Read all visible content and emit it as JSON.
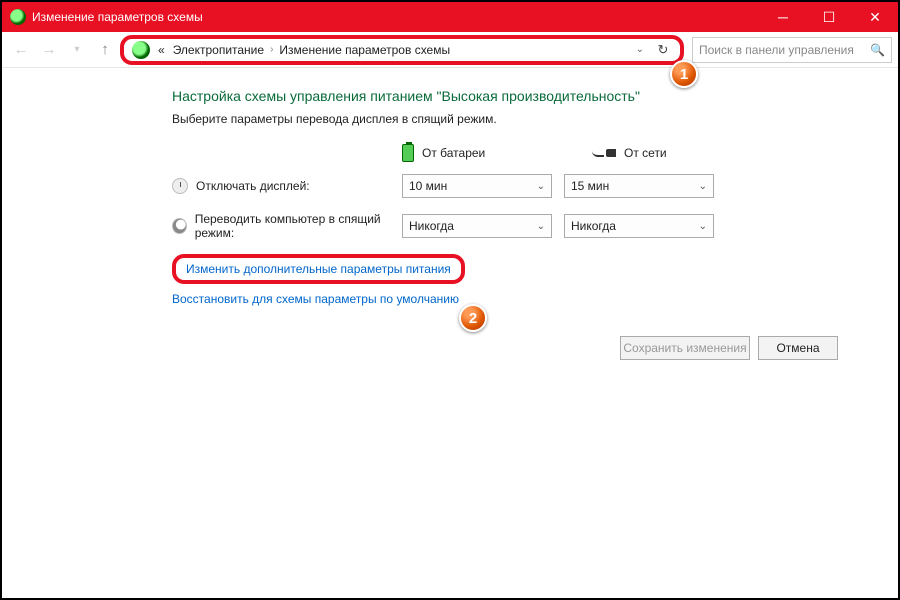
{
  "titlebar": {
    "title": "Изменение параметров схемы"
  },
  "breadcrumb": {
    "prefix": "«",
    "seg1": "Электропитание",
    "seg2": "Изменение параметров схемы"
  },
  "search": {
    "placeholder": "Поиск в панели управления"
  },
  "main": {
    "heading": "Настройка схемы управления питанием \"Высокая производительность\"",
    "subtitle": "Выберите параметры перевода дисплея в спящий режим.",
    "col_battery": "От батареи",
    "col_ac": "От сети",
    "row_display_label": "Отключать дисплей:",
    "row_display_batt": "10 мин",
    "row_display_ac": "15 мин",
    "row_sleep_label": "Переводить компьютер в спящий режим:",
    "row_sleep_batt": "Никогда",
    "row_sleep_ac": "Никогда",
    "link_advanced": "Изменить дополнительные параметры питания",
    "link_restore": "Восстановить для схемы параметры по умолчанию",
    "btn_save": "Сохранить изменения",
    "btn_cancel": "Отмена"
  },
  "badges": {
    "one": "1",
    "two": "2"
  }
}
